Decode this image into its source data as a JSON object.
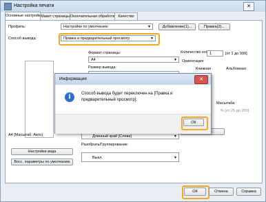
{
  "window": {
    "title": "Настройка печати"
  },
  "tabs": [
    "Основные настройки",
    "Макет страницы",
    "Окончательная обработка",
    "Качество"
  ],
  "profile": {
    "label": "Профиль:",
    "value": "Настройки по умолчанию",
    "add_btn": "Добавление(1)...",
    "edit_btn": "Правка(2)..."
  },
  "output": {
    "label": "Способ вывода:",
    "value": "Правка и предварительный просмотр"
  },
  "page_format": {
    "label": "Формат страницы:",
    "value": "A4"
  },
  "output_size": {
    "label": "Размер вывода:"
  },
  "copies": {
    "label": "Количество копий:",
    "value": "1",
    "range": "[от 1 до 999]"
  },
  "orientation": {
    "label": "Ориентация",
    "portrait": "Книжная",
    "landscape": "Альбомная"
  },
  "scale": {
    "label": "Масштаба",
    "range": "% [от 25 до 200]"
  },
  "right_btn": "Параметр...",
  "binding": {
    "value": "Длинный край [Слева]"
  },
  "collate": {
    "label": "Разобрать/Группирование:",
    "value": "Выкл."
  },
  "preview_caption": "А4 [Масштаб: Авто]",
  "left_buttons": {
    "view_settings": "Настройки вида",
    "restore": "Восс. параметры по умолчанию"
  },
  "footer": {
    "ok": "ОК",
    "cancel": "Отмена",
    "help": "Справка"
  },
  "dialog": {
    "title": "Информация",
    "message": "Способ вывода будет переключен на [Правка и предварительный просмотр].",
    "ok": "ОК"
  }
}
